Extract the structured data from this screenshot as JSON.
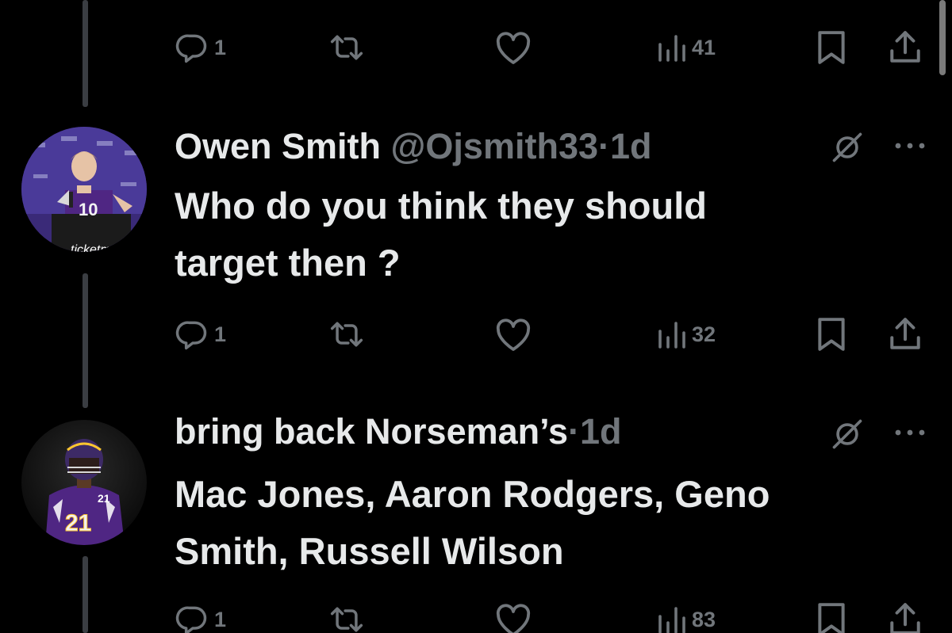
{
  "tweets": [
    {
      "actions": {
        "replies": "1",
        "reposts": "",
        "likes": "",
        "views": "41"
      }
    },
    {
      "author_name": "Owen Smith",
      "handle": "@Ojsmith33",
      "separator": "·",
      "time": "1d",
      "text_line1": "Who do you think they should",
      "text_line2": "target then ?",
      "actions": {
        "replies": "1",
        "reposts": "",
        "likes": "",
        "views": "32"
      }
    },
    {
      "author_name": "bring back Norseman’s",
      "separator": "·",
      "time": "1d",
      "text_line1": "Mac Jones, Aaron Rodgers, Geno",
      "text_line2": "Smith, Russell Wilson",
      "actions": {
        "replies": "1",
        "reposts": "",
        "likes": "",
        "views": "83"
      }
    }
  ],
  "icons": {
    "reply": "reply-icon",
    "repost": "repost-icon",
    "like": "heart-icon",
    "views": "views-icon",
    "bookmark": "bookmark-icon",
    "share": "share-icon",
    "grok": "grok-icon",
    "more": "more-icon"
  },
  "colors": {
    "background": "#000000",
    "primary_text": "#e7e9ea",
    "secondary_text": "#71767b",
    "thread_line": "#3a3d42",
    "vikings_purple": "#4f2683",
    "vikings_gold": "#ffc62f"
  }
}
